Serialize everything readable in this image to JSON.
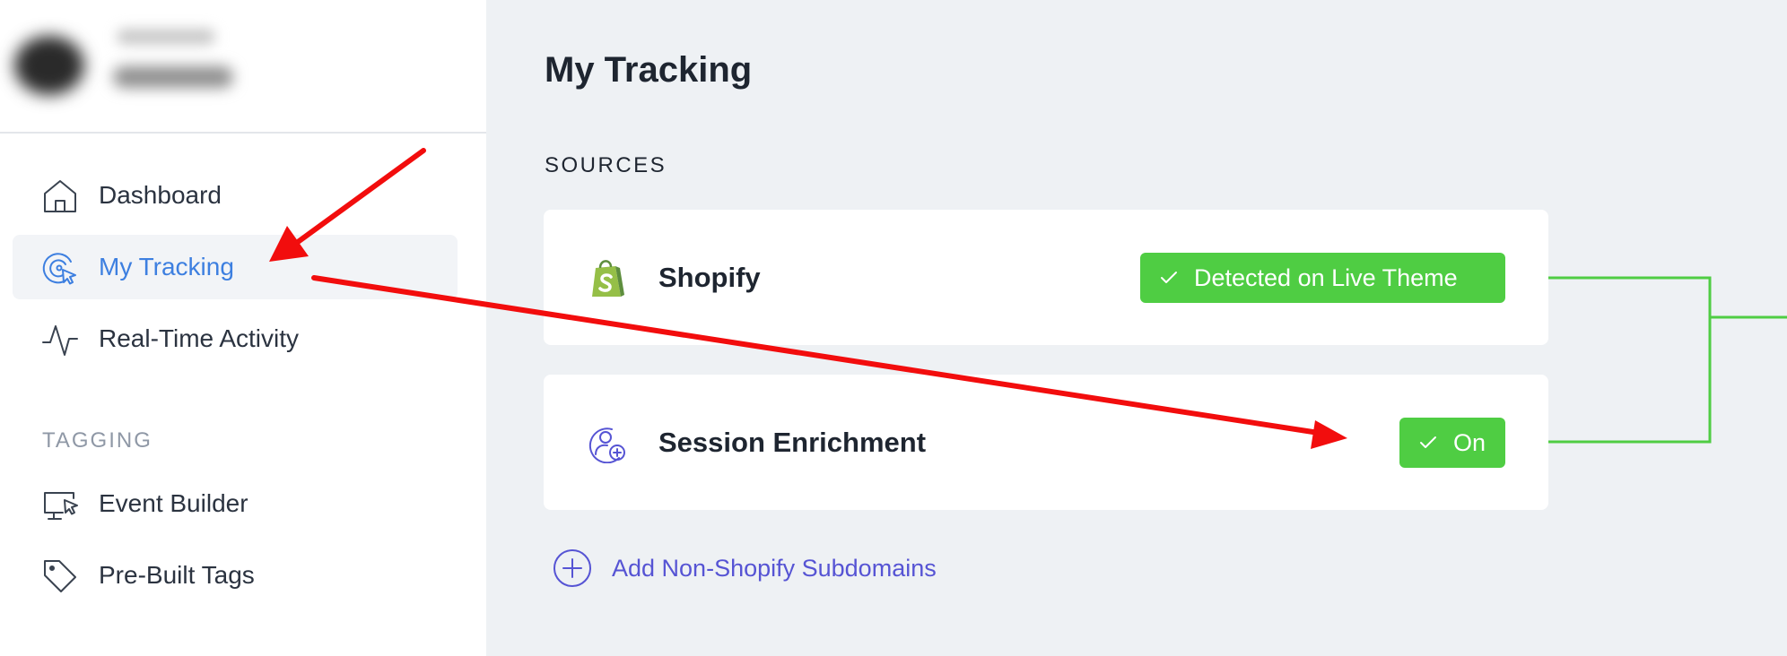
{
  "sidebar": {
    "nav": [
      {
        "label": "Dashboard",
        "icon": "home-icon",
        "active": false
      },
      {
        "label": "My Tracking",
        "icon": "target-cursor-icon",
        "active": true
      },
      {
        "label": "Real-Time Activity",
        "icon": "activity-pulse-icon",
        "active": false
      }
    ],
    "tagging_section": {
      "title": "TAGGING",
      "items": [
        {
          "label": "Event Builder",
          "icon": "monitor-cursor-icon"
        },
        {
          "label": "Pre-Built Tags",
          "icon": "tag-icon"
        }
      ]
    }
  },
  "main": {
    "title": "My Tracking",
    "sources_label": "SOURCES",
    "sources": [
      {
        "name": "Shopify",
        "icon": "shopify-bag-icon",
        "status": "Detected on Live Theme",
        "status_icon": "check-icon"
      },
      {
        "name": "Session Enrichment",
        "icon": "user-plus-icon",
        "status": "On",
        "status_icon": "check-icon"
      }
    ],
    "add_link": {
      "label": "Add Non-Shopify Subdomains",
      "icon": "plus-circle-icon"
    }
  },
  "colors": {
    "accent_blue": "#3d7fe0",
    "link_purple": "#5654d4",
    "status_green": "#4fcd43",
    "annotation_red": "#f20d0d",
    "connector_green": "#4fcd43"
  }
}
